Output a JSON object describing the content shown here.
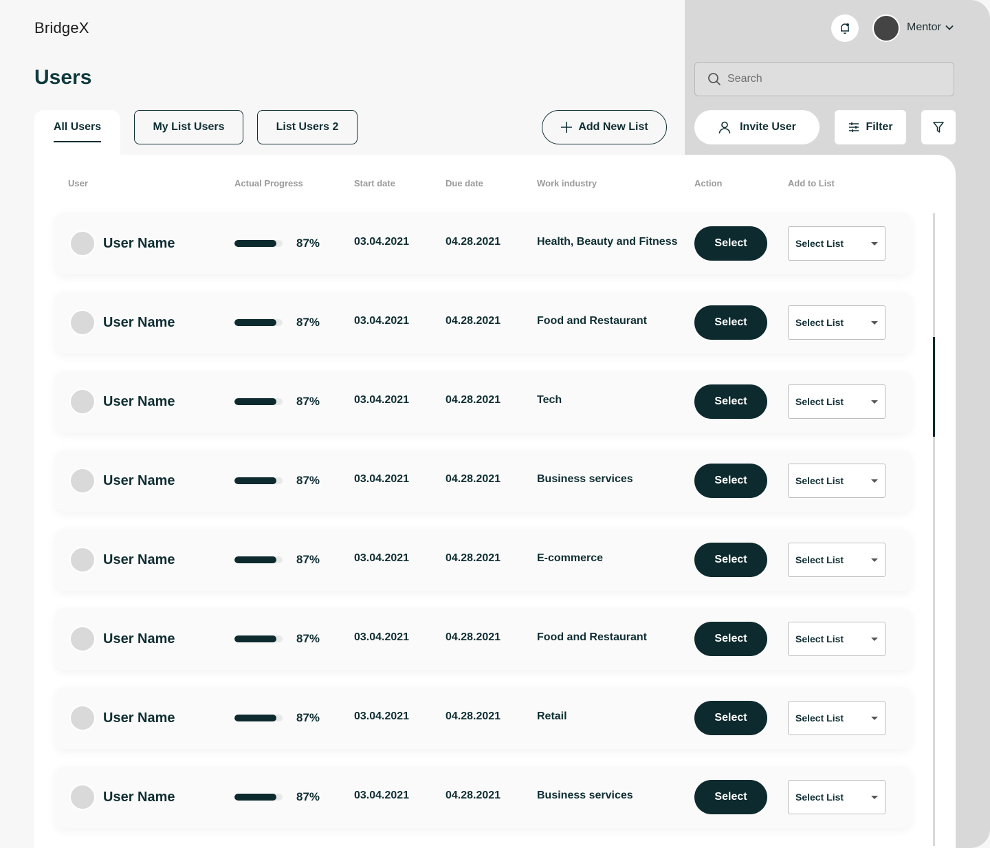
{
  "app": {
    "logo": "BridgeX"
  },
  "page": {
    "title": "Users"
  },
  "tabs": [
    {
      "label": "All Users",
      "active": true
    },
    {
      "label": "My List Users",
      "active": false
    },
    {
      "label": "List Users 2",
      "active": false
    }
  ],
  "add_new_list_label": "Add New List",
  "header": {
    "role_label": "Mentor",
    "notification_icon": "bell-icon"
  },
  "search": {
    "placeholder": "Search"
  },
  "actions": {
    "invite_label": "Invite User",
    "filter_label": "Filter"
  },
  "table": {
    "columns": [
      "User",
      "Actual Progress",
      "Start date",
      "Due date",
      "Work industry",
      "Action",
      "Add to List"
    ],
    "rows": [
      {
        "name": "User Name",
        "progress_label": "87%",
        "progress": 0.87,
        "start": "03.04.2021",
        "due": "04.28.2021",
        "industry": "Health, Beauty and Fitness",
        "action": "Select",
        "list": "Select List"
      },
      {
        "name": "User Name",
        "progress_label": "87%",
        "progress": 0.87,
        "start": "03.04.2021",
        "due": "04.28.2021",
        "industry": "Food and Restaurant",
        "action": "Select",
        "list": "Select List"
      },
      {
        "name": "User Name",
        "progress_label": "87%",
        "progress": 0.87,
        "start": "03.04.2021",
        "due": "04.28.2021",
        "industry": "Tech",
        "action": "Select",
        "list": "Select List"
      },
      {
        "name": "User Name",
        "progress_label": "87%",
        "progress": 0.87,
        "start": "03.04.2021",
        "due": "04.28.2021",
        "industry": "Business services",
        "action": "Select",
        "list": "Select List"
      },
      {
        "name": "User Name",
        "progress_label": "87%",
        "progress": 0.87,
        "start": "03.04.2021",
        "due": "04.28.2021",
        "industry": "E-commerce",
        "action": "Select",
        "list": "Select List"
      },
      {
        "name": "User Name",
        "progress_label": "87%",
        "progress": 0.87,
        "start": "03.04.2021",
        "due": "04.28.2021",
        "industry": "Food and Restaurant",
        "action": "Select",
        "list": "Select List"
      },
      {
        "name": "User Name",
        "progress_label": "87%",
        "progress": 0.87,
        "start": "03.04.2021",
        "due": "04.28.2021",
        "industry": "Retail",
        "action": "Select",
        "list": "Select List"
      },
      {
        "name": "User Name",
        "progress_label": "87%",
        "progress": 0.87,
        "start": "03.04.2021",
        "due": "04.28.2021",
        "industry": "Business services",
        "action": "Select",
        "list": "Select List"
      }
    ]
  },
  "colors": {
    "primary": "#0d2a2e",
    "background": "#f7f7f7",
    "panel": "#d8d8d8"
  }
}
